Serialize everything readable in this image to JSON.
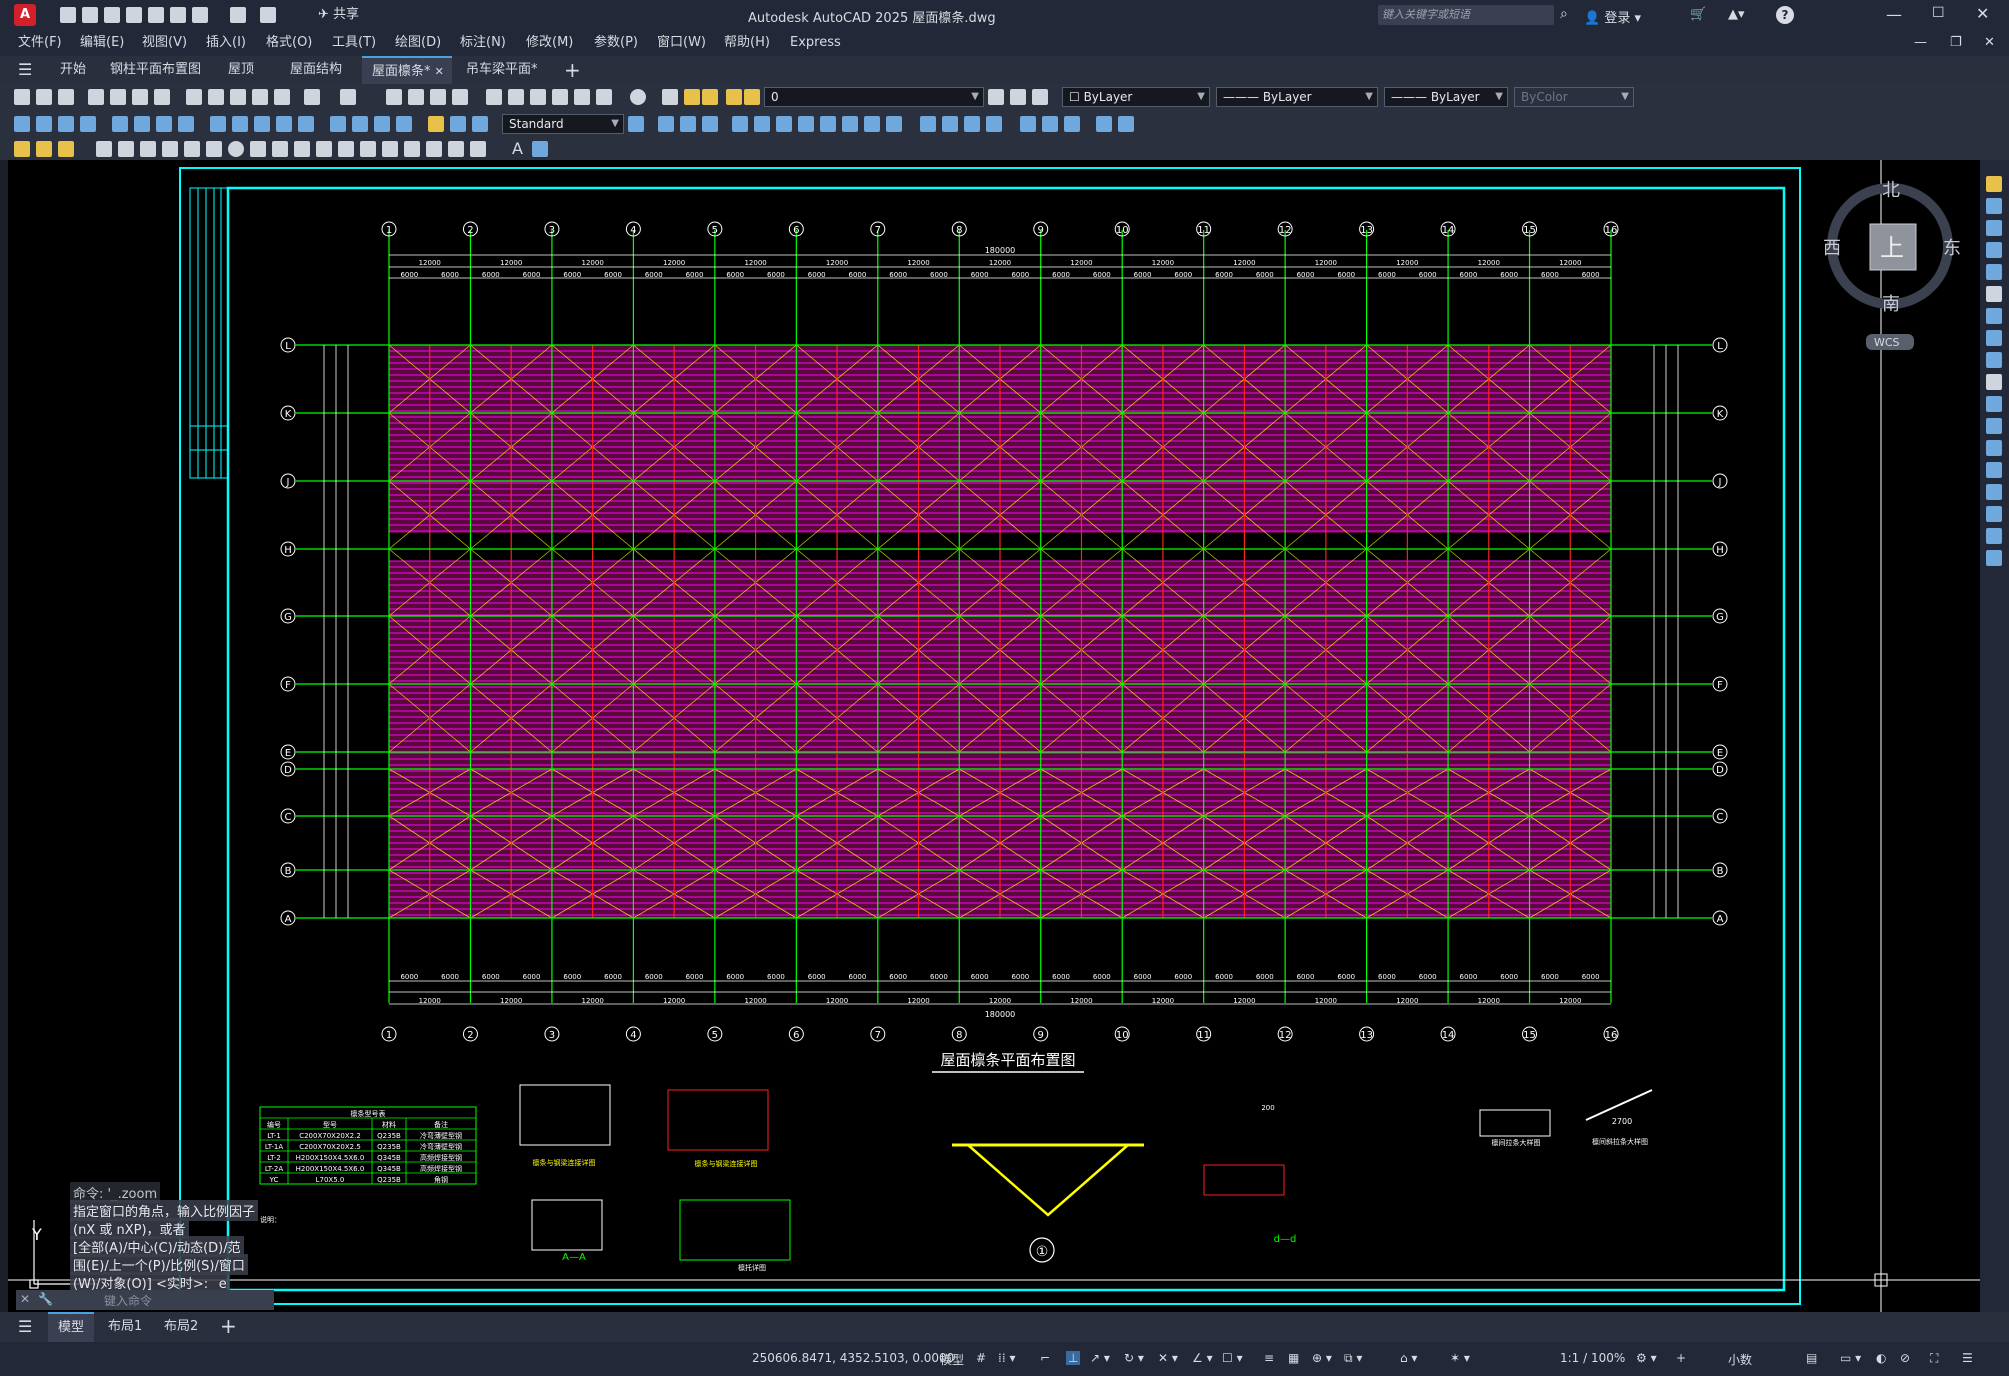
{
  "titlebar": {
    "app_icon": "A",
    "share_label": "共享",
    "title": "Autodesk AutoCAD 2025    屋面檩条.dwg",
    "search_placeholder": "键入关键字或短语",
    "login_label": "登录"
  },
  "menu": [
    "文件(F)",
    "编辑(E)",
    "视图(V)",
    "插入(I)",
    "格式(O)",
    "工具(T)",
    "绘图(D)",
    "标注(N)",
    "修改(M)",
    "参数(P)",
    "窗口(W)",
    "帮助(H)",
    "Express"
  ],
  "doc_tabs": [
    {
      "label": "开始",
      "active": false
    },
    {
      "label": "钢柱平面布置图",
      "active": false
    },
    {
      "label": "屋顶",
      "active": false
    },
    {
      "label": "屋面结构",
      "active": false
    },
    {
      "label": "屋面檩条*",
      "active": true
    },
    {
      "label": "吊车梁平面*",
      "active": false
    }
  ],
  "toolbars": {
    "layer_value": "0",
    "color_value": "ByLayer",
    "linetype_value": "ByLayer",
    "lineweight_value": "ByLayer",
    "plotstyle_value": "ByColor",
    "textstyle_value": "Standard"
  },
  "viewcube": {
    "north": "北",
    "south": "南",
    "east": "东",
    "west": "西",
    "top": "上",
    "wcs": "WCS"
  },
  "drawing": {
    "main_title": "屋面檩条平面布置图",
    "axis_numbers": [
      "1",
      "2",
      "3",
      "4",
      "5",
      "6",
      "7",
      "8",
      "9",
      "10",
      "11",
      "12",
      "13",
      "14",
      "15",
      "16"
    ],
    "axis_letters": [
      "L",
      "K",
      "J",
      "H",
      "G",
      "F",
      "E",
      "D",
      "C",
      "B",
      "A"
    ],
    "top_dims_12000": [
      "12000",
      "12000",
      "12000",
      "12000",
      "12000",
      "12000",
      "12000",
      "12000",
      "12000",
      "12000",
      "12000",
      "12000",
      "12000",
      "12000",
      "12000"
    ],
    "half_dim": "6000",
    "total_dim": "180000",
    "table_title": "檩条型号表",
    "table_headers": [
      "编号",
      "型号",
      "材料",
      "备注"
    ],
    "table_rows": [
      [
        "LT-1",
        "C200X70X20X2.2",
        "Q235B",
        "冷弯薄壁型钢"
      ],
      [
        "LT-1A",
        "C200X70X20X2.5",
        "Q235B",
        "冷弯薄壁型钢"
      ],
      [
        "LT-2",
        "H200X150X4.5X6.0",
        "Q345B",
        "高频焊接型钢"
      ],
      [
        "LT-2A",
        "H200X150X4.5X6.0",
        "Q345B",
        "高频焊接型钢"
      ],
      [
        "YC",
        "L70X5.0",
        "Q235B",
        "角钢"
      ]
    ],
    "note_label": "说明：",
    "section_label_aa": "A—A",
    "section_label_dd": "d—d",
    "detail_num": "①",
    "detail_caption_1": "檩条与钢梁连接详图",
    "detail_caption_2": "檩条与钢梁连接详图",
    "detail_caption_3": "檩托详图",
    "detail_caption_4": "檩间拉条大样图",
    "detail_caption_5": "檩间斜拉条大样图",
    "dim_2700": "2700",
    "dim_200": "200"
  },
  "command": {
    "line1": "命令: '_.zoom",
    "line2": "指定窗口的角点，输入比例因子",
    "line3": "(nX 或 nXP)，或者",
    "line4": "[全部(A)/中心(C)/动态(D)/范",
    "line5": "围(E)/上一个(P)/比例(S)/窗口",
    "line6": "(W)/对象(O)] <实时>: _e",
    "input_placeholder": "键入命令"
  },
  "layout_tabs": [
    {
      "label": "模型",
      "active": true
    },
    {
      "label": "布局1",
      "active": false
    },
    {
      "label": "布局2",
      "active": false
    }
  ],
  "status": {
    "coords": "250606.8471, 4352.5103, 0.0000",
    "mode": "模型",
    "scale": "1:1 / 100%",
    "units": "小数"
  },
  "colors": {
    "frame": "#00ffff",
    "axis": "#00ff00",
    "purlin": "#ff00ff",
    "brace": "#ffff00",
    "dim": "#ffffff",
    "beam": "#ff2020"
  }
}
